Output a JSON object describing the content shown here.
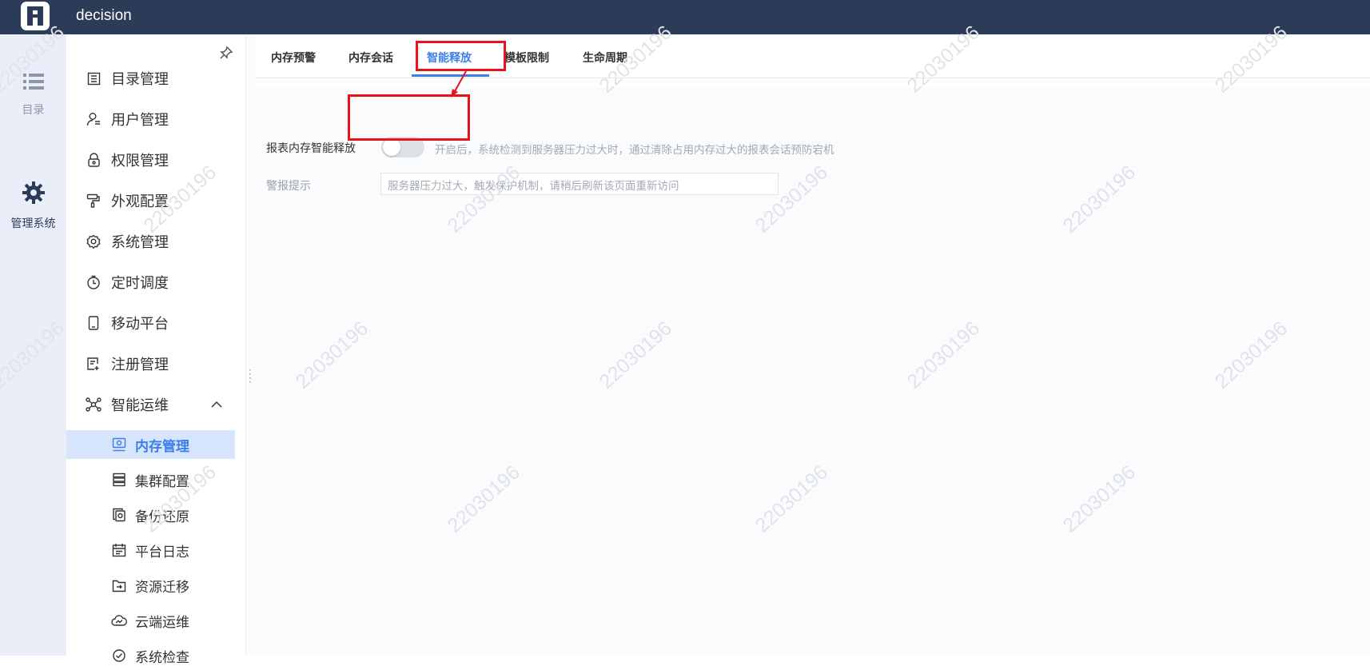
{
  "app": {
    "title": "decision"
  },
  "rail": {
    "items": [
      {
        "label": "目录",
        "icon": "list-icon"
      },
      {
        "label": "管理系统",
        "icon": "gear-icon"
      }
    ]
  },
  "menu": {
    "items": [
      {
        "label": "目录管理",
        "icon": "catalog-icon"
      },
      {
        "label": "用户管理",
        "icon": "user-icon"
      },
      {
        "label": "权限管理",
        "icon": "lock-icon"
      },
      {
        "label": "外观配置",
        "icon": "paint-roller-icon"
      },
      {
        "label": "系统管理",
        "icon": "settings-icon"
      },
      {
        "label": "定时调度",
        "icon": "timer-icon"
      },
      {
        "label": "移动平台",
        "icon": "mobile-icon"
      },
      {
        "label": "注册管理",
        "icon": "register-icon"
      },
      {
        "label": "智能运维",
        "icon": "network-icon"
      }
    ],
    "sub_items": [
      {
        "label": "内存管理",
        "icon": "memory-icon",
        "active": true
      },
      {
        "label": "集群配置",
        "icon": "server-icon"
      },
      {
        "label": "备份还原",
        "icon": "backup-icon"
      },
      {
        "label": "平台日志",
        "icon": "log-icon"
      },
      {
        "label": "资源迁移",
        "icon": "folder-migrate-icon"
      },
      {
        "label": "云端运维",
        "icon": "cloud-icon"
      },
      {
        "label": "系统检查",
        "icon": "check-icon"
      }
    ]
  },
  "tabs": [
    {
      "label": "内存预警"
    },
    {
      "label": "内存会话"
    },
    {
      "label": "智能释放",
      "active": true
    },
    {
      "label": "模板限制"
    },
    {
      "label": "生命周期"
    }
  ],
  "form": {
    "smart_release_label": "报表内存智能释放",
    "smart_release_enabled": false,
    "smart_release_help": "开启后，系统检测到服务器压力过大时，通过清除占用内存过大的报表会话预防宕机",
    "alert_label": "警报提示",
    "alert_placeholder": "服务器压力过大，触发保护机制，请稍后刷新该页面重新访问"
  },
  "watermark": "22030196",
  "colors": {
    "topbar": "#2c3b58",
    "accent": "#3d7ee8",
    "annotation": "#e8141b",
    "rail_bg": "#e9eef8",
    "active_item_bg": "#d6e5fb"
  }
}
